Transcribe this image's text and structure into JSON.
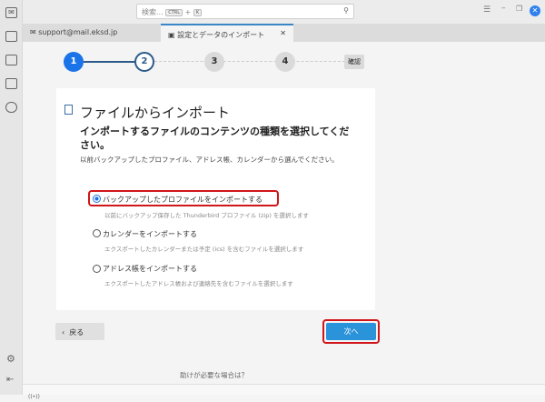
{
  "search": {
    "placeholder": "検索...",
    "shortcut_ctrl": "CTRL",
    "shortcut_plus": "+",
    "shortcut_key": "K"
  },
  "tabs": [
    {
      "label": "support@mail.eksd.jp"
    },
    {
      "label": "設定とデータのインポート"
    }
  ],
  "steps": [
    "1",
    "2",
    "3",
    "4",
    "確認"
  ],
  "card": {
    "title": "ファイルからインポート",
    "heading": "インポートするファイルのコンテンツの種類を選択してください。",
    "subtitle": "以前バックアップしたプロファイル、アドレス帳、カレンダーから選んでください。",
    "options": [
      {
        "label": "バックアップしたプロファイルをインポートする",
        "desc": "以前にバックアップ保存した Thunderbird プロファイル (zip) を選択します",
        "selected": true
      },
      {
        "label": "カレンダーをインポートする",
        "desc": "エクスポートしたカレンダーまたは予定 (ics) を含むファイルを選択します",
        "selected": false
      },
      {
        "label": "アドレス帳をインポートする",
        "desc": "エクスポートしたアドレス帳および連絡先を含むファイルを選択します",
        "selected": false
      }
    ]
  },
  "buttons": {
    "back": "戻る",
    "next": "次へ"
  },
  "help": "助けが必要な場合は？",
  "status": "((•))",
  "colors": {
    "accent": "#1a73e8",
    "next": "#2b93da",
    "highlight": "#d0161a"
  }
}
